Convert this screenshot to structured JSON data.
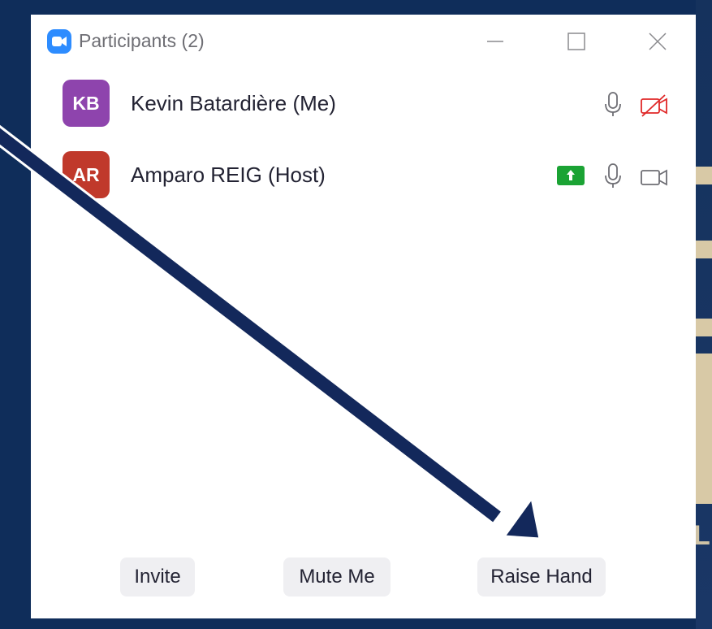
{
  "window": {
    "title": "Participants (2)",
    "logo_icon": "zoom-camera-icon",
    "controls": [
      "minimize-icon",
      "maximize-icon",
      "close-icon"
    ]
  },
  "participants": [
    {
      "initials": "KB",
      "name": "Kevin Batardière (Me)",
      "avatar_color": "#8e44ad",
      "mic_icon": "microphone-icon",
      "video_icon": "video-off-icon",
      "raised_hand": false
    },
    {
      "initials": "AR",
      "name": "Amparo REIG (Host)",
      "avatar_color": "#c0392b",
      "hand_icon": "raise-hand-icon",
      "mic_icon": "microphone-icon",
      "video_icon": "video-icon",
      "raised_hand": true
    }
  ],
  "footer": {
    "invite_label": "Invite",
    "mute_label": "Mute Me",
    "raise_label": "Raise Hand"
  },
  "colors": {
    "background": "#0f2d5a",
    "arrow": "#13285b",
    "video_off": "#e02828",
    "raised_hand": "#1ba334",
    "button_bg": "#efeff2"
  }
}
